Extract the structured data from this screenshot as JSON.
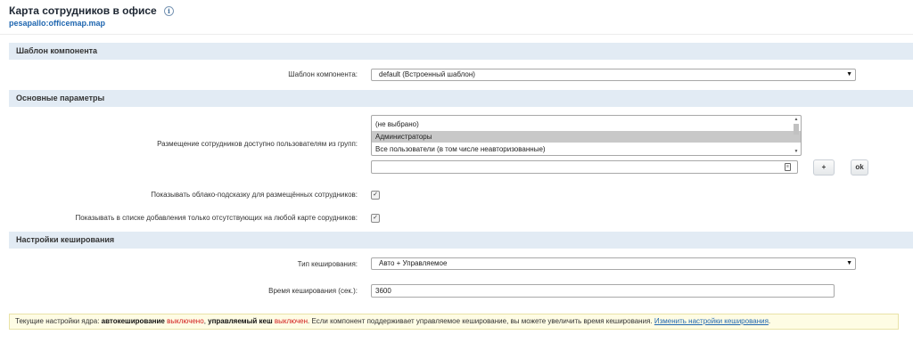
{
  "header": {
    "title": "Карта сотрудников в офисе",
    "subtitle": "pesapallo:officemap.map",
    "info_icon": "info-icon"
  },
  "sections": {
    "template": "Шаблон компонента",
    "main": "Основные параметры",
    "cache": "Настройки кеширования"
  },
  "template_field": {
    "label": "Шаблон компонента:",
    "value": "default (Встроенный шаблон)"
  },
  "groups_field": {
    "label": "Размещение сотрудников доступно пользователям из групп:",
    "options": [
      "(не выбрано)",
      "Администраторы",
      "Все пользователи (в том числе неавторизованные)"
    ],
    "selected": "Администраторы",
    "extra_value": "",
    "add_label": "+",
    "ok_label": "ok"
  },
  "tooltip_field": {
    "label": "Показывать облако-подсказку для размещённых сотрудников:",
    "checked": true
  },
  "absent_field": {
    "label": "Показывать в списке добавления только отсутствующих на любой карте сорудников:",
    "checked": true
  },
  "cache_type_field": {
    "label": "Тип кеширования:",
    "value": "Авто + Управляемое"
  },
  "cache_time_field": {
    "label": "Время кеширования (сек.):",
    "value": "3600"
  },
  "notice": {
    "prefix": "Текущие настройки ядра: ",
    "auto_label": "автокеширование",
    "auto_state": "выключено",
    "sep": ", ",
    "managed_label": "управляемый кеш",
    "managed_state": "выключен",
    "middle": ". Если компонент поддерживает управляемое кеширование, вы можете увеличить время кеширования. ",
    "link": "Изменить настройки кеширования",
    "suffix": "."
  },
  "colors": {
    "section_bg": "#e2ebf4",
    "link": "#2067b0",
    "off_state": "#d11a1a",
    "notice_bg": "#fefce4"
  }
}
